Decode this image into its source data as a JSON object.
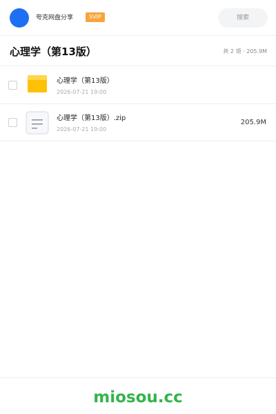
{
  "header": {
    "username": "夸克网盘分享",
    "badge": "SVIP",
    "search_label": "搜索"
  },
  "folder": {
    "title": "心理学（第13版）",
    "summary": "共 2 项 · 205.9M"
  },
  "files": [
    {
      "name": "心理学（第13版）",
      "date": "2026-07-21 19:00",
      "size": "",
      "icon": "folder-icon"
    },
    {
      "name": "心理学（第13版）.zip",
      "date": "2026-07-21 19:00",
      "size": "205.9M",
      "icon": "zip-file-icon"
    }
  ],
  "footer": {
    "brand": "miosou.cc"
  },
  "colors": {
    "avatar": "#1e6ff2",
    "badge": "#f7a43a",
    "folder": "#ffc107",
    "brand": "#34b34a"
  }
}
